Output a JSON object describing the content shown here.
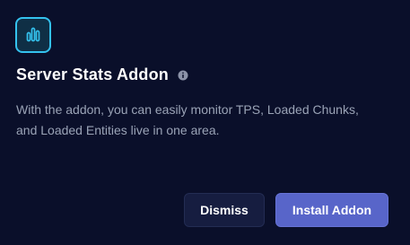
{
  "addon": {
    "icon": "bar-chart-icon",
    "title": "Server Stats Addon",
    "info_icon": "info-icon",
    "description": "With the addon, you can easily monitor TPS, Loaded Chunks, and Loaded Entities live in one area."
  },
  "actions": {
    "dismiss_label": "Dismiss",
    "install_label": "Install Addon"
  },
  "colors": {
    "background": "#0a0f2a",
    "accent": "#34c2ee",
    "primary_button": "#5865c9",
    "secondary_button": "#161d40"
  }
}
